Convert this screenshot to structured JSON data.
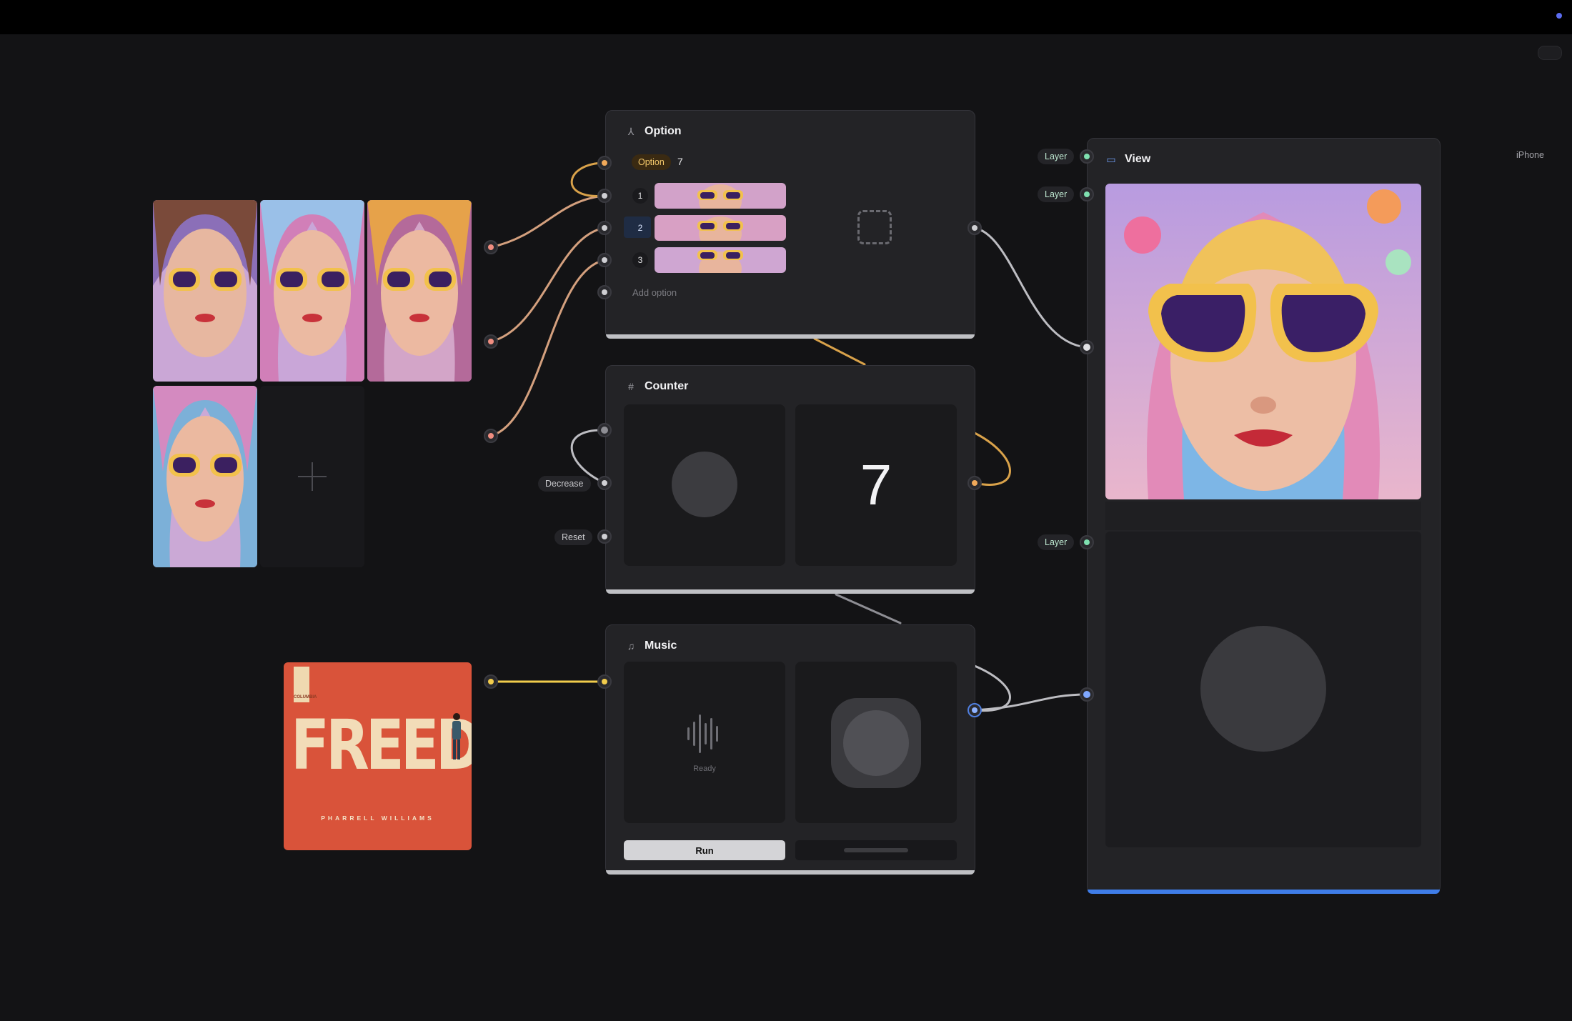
{
  "colors": {
    "orange_port": "#f0a95a",
    "salmon_port": "#f08d80",
    "yellow_port": "#f2cc4c",
    "green_port": "#7fe0b0",
    "blue_port": "#7fa8ff",
    "accent_blue": "#3f7de8"
  },
  "image_grid": {
    "tiles": [
      "sunglasses-girl-1",
      "sunglasses-girl-2",
      "sunglasses-girl-3",
      "sunglasses-girl-4"
    ],
    "add_icon": "plus-icon"
  },
  "option_node": {
    "title": "Option",
    "icon": "branch-icon",
    "badge": "Option",
    "value": "7",
    "options": [
      {
        "index": "1",
        "selected": false
      },
      {
        "index": "2",
        "selected": true
      },
      {
        "index": "3",
        "selected": false
      }
    ],
    "add_option": "Add option",
    "output_icon": "dashed-square-icon"
  },
  "counter_node": {
    "title": "Counter",
    "icon": "#",
    "value": "7",
    "inputs": [
      "Decrease",
      "Reset"
    ]
  },
  "music_node": {
    "title": "Music",
    "icon": "music-note-icon",
    "status": "Ready",
    "run_label": "Run"
  },
  "album": {
    "title": "FREEDOM!",
    "artist": "PHARRELL WILLIAMS",
    "label_text": "COLUMBIA"
  },
  "view_node": {
    "title": "View",
    "device": "iPhone",
    "layers": [
      "Layer",
      "Layer",
      "Layer"
    ]
  }
}
